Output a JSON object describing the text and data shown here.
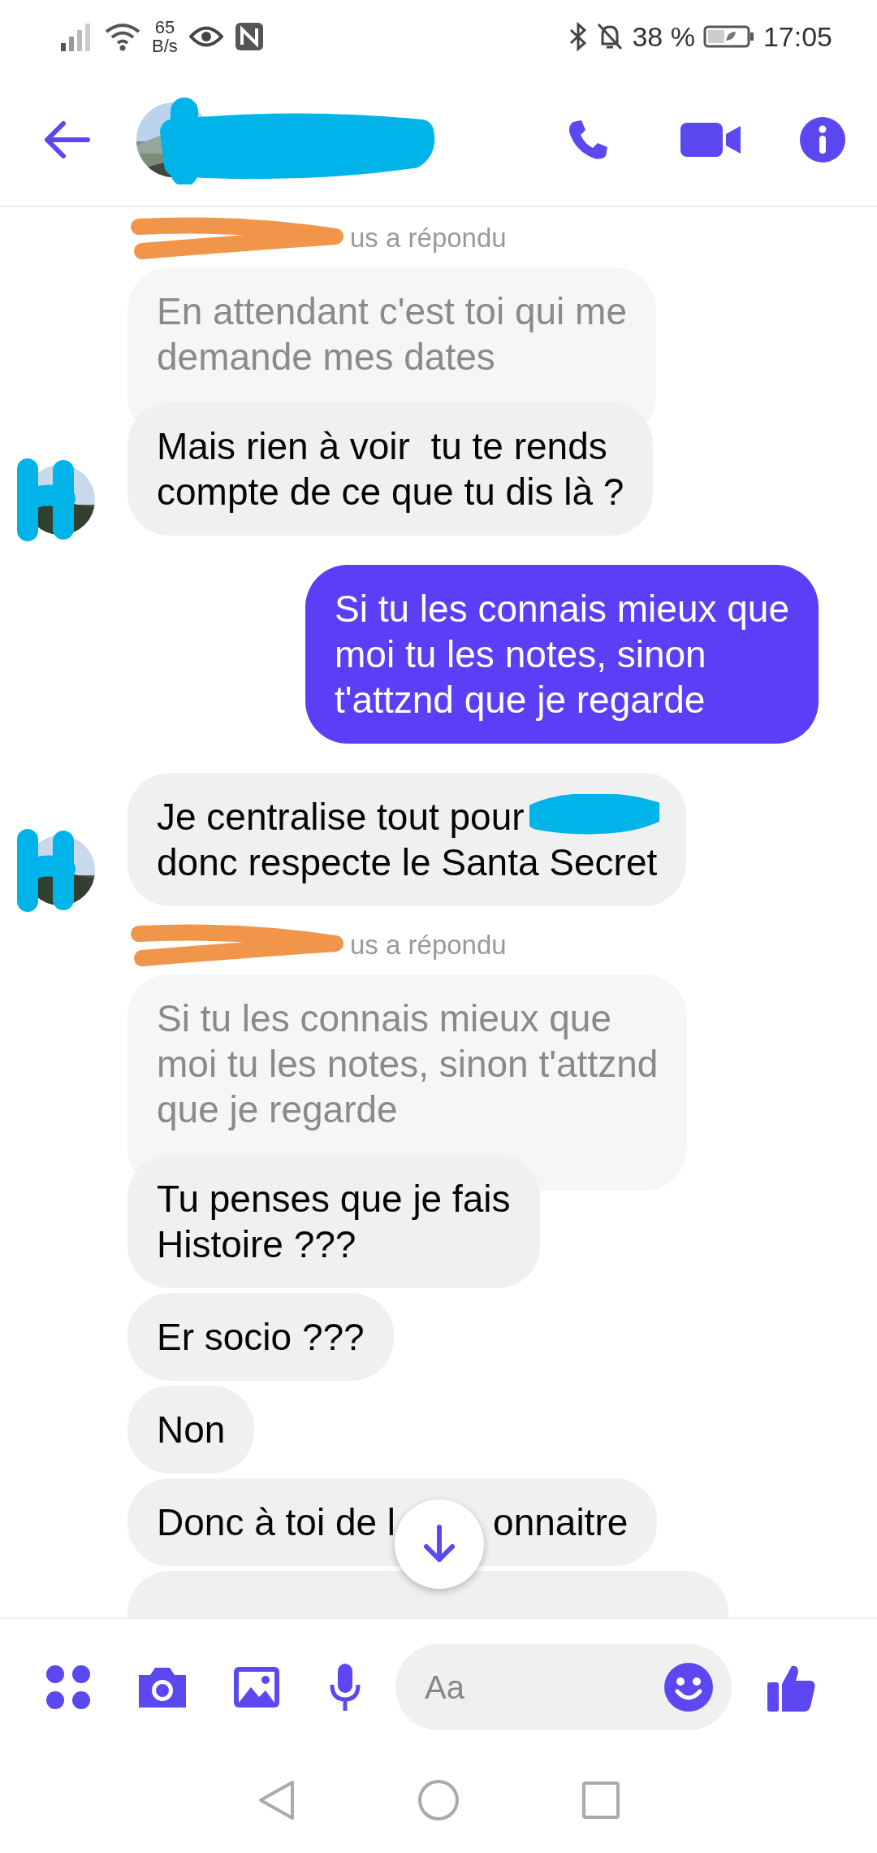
{
  "status_bar": {
    "net_speed_value": "65",
    "net_speed_unit": "B/s",
    "battery": "38 %",
    "time": "17:05"
  },
  "messages": [
    {
      "kind": "reply_label",
      "text": "us a répondu"
    },
    {
      "kind": "quoted",
      "text": "En attendant c'est toi qui me\ndemande mes dates"
    },
    {
      "kind": "received",
      "text": "Mais rien à voir  tu te rends\ncompte de ce que tu dis là ?",
      "avatar": true
    },
    {
      "kind": "sent",
      "text": "Si tu les connais mieux que\nmoi tu les notes, sinon\nt'attznd que je regarde"
    },
    {
      "kind": "received_redacted",
      "parts": [
        "Je centralise tout pour",
        "donc respecte le Santa Secret"
      ],
      "avatar": true
    },
    {
      "kind": "reply_label",
      "text": "us a répondu"
    },
    {
      "kind": "quoted",
      "text": "Si tu les connais mieux que\nmoi tu les notes, sinon t'attznd\nque je regarde"
    },
    {
      "kind": "received",
      "text": "Tu penses que je fais\nHistoire ???",
      "avatar": false
    },
    {
      "kind": "received",
      "text": "Er socio ???",
      "avatar": false
    },
    {
      "kind": "received",
      "text": "Non",
      "avatar": false
    },
    {
      "kind": "received_covered",
      "parts": [
        "Donc à toi de l",
        "onnaitre"
      ],
      "avatar": false
    },
    {
      "kind": "received_cut",
      "avatar": false
    }
  ],
  "composer": {
    "placeholder": "Aa"
  }
}
